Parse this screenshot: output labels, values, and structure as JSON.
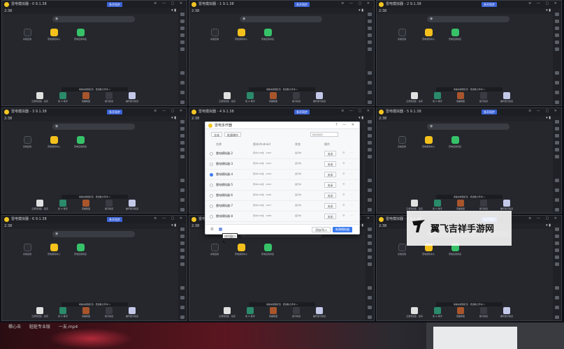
{
  "emulator": {
    "badge": "多开同步",
    "window_titles": [
      "雷电模拟器 - 0 9.1.38",
      "雷电模拟器 - 1 9.1.38",
      "雷电模拟器 - 2 9.1.38",
      "雷电模拟器 - 3 9.1.38",
      "雷电模拟器 - 4 9.1.38",
      "雷电模拟器 - 5 9.1.38",
      "雷电模拟器 - 6 9.1.38",
      "雷电模拟器 - 7 9.1.38",
      "雷电模拟器 - 8 9.1.38"
    ],
    "time": "2:38",
    "home_apps": [
      {
        "label": "系统应用",
        "color": "#2b2e35",
        "icon": "apps-grid-icon"
      },
      {
        "label": "雷电游戏中心",
        "color": "#f4c11c",
        "icon": "gamepad-icon"
      },
      {
        "label": "雷电应用商店",
        "color": "#37c26a",
        "icon": "store-icon"
      }
    ],
    "dock_tip": "考察央视频红包 · 低加助力手中 >",
    "dock_apps": [
      {
        "label": "云游戏合集 · 蓝宗",
        "color": "#e0e0e0"
      },
      {
        "label": "和 Ai 助手",
        "color": "#2a8a6a"
      },
      {
        "label": "英雄联盟",
        "color": "#a8552c"
      },
      {
        "label": "星穹铁道",
        "color": "#3b3b44"
      },
      {
        "label": "崩坏星穹铁道",
        "color": "#c4c8e8"
      }
    ]
  },
  "manager": {
    "title": "雷电多开器",
    "buttons": {
      "select_all": "全选",
      "batch_ops": "批量操作",
      "sort": "按名称排序",
      "close": "关闭"
    },
    "headers": {
      "name": "名称",
      "version": "版本/Android",
      "status": "状态",
      "ops": "操作"
    },
    "rows": [
      {
        "name": "雷电模拟器-2",
        "version": "安卓9 64位 · 1002",
        "status": "运行中",
        "checked": false
      },
      {
        "name": "雷电模拟器-3",
        "version": "安卓9 64位 · 1003",
        "status": "运行中",
        "checked": false
      },
      {
        "name": "雷电模拟器-4",
        "version": "安卓9 64位 · 1004",
        "status": "运行中",
        "checked": true
      },
      {
        "name": "雷电模拟器-5",
        "version": "安卓9 64位 · 1005",
        "status": "运行中",
        "checked": false
      },
      {
        "name": "雷电模拟器-6",
        "version": "安卓9 64位 · 1006",
        "status": "运行中",
        "checked": false
      },
      {
        "name": "雷电模拟器-7",
        "version": "安卓9 64位 · 1007",
        "status": "运行中",
        "checked": false
      },
      {
        "name": "雷电模拟器-8",
        "version": "安卓9 64位 · 1008",
        "status": "运行中",
        "checked": false
      }
    ],
    "footer": {
      "import": "添加/导入",
      "add": "新建模拟器"
    },
    "tooltip": "排列窗口"
  },
  "watermark": "翼飞吉祥手游网",
  "bottom_text": "椰心去　　脏脏专业版　　一友.mp4"
}
